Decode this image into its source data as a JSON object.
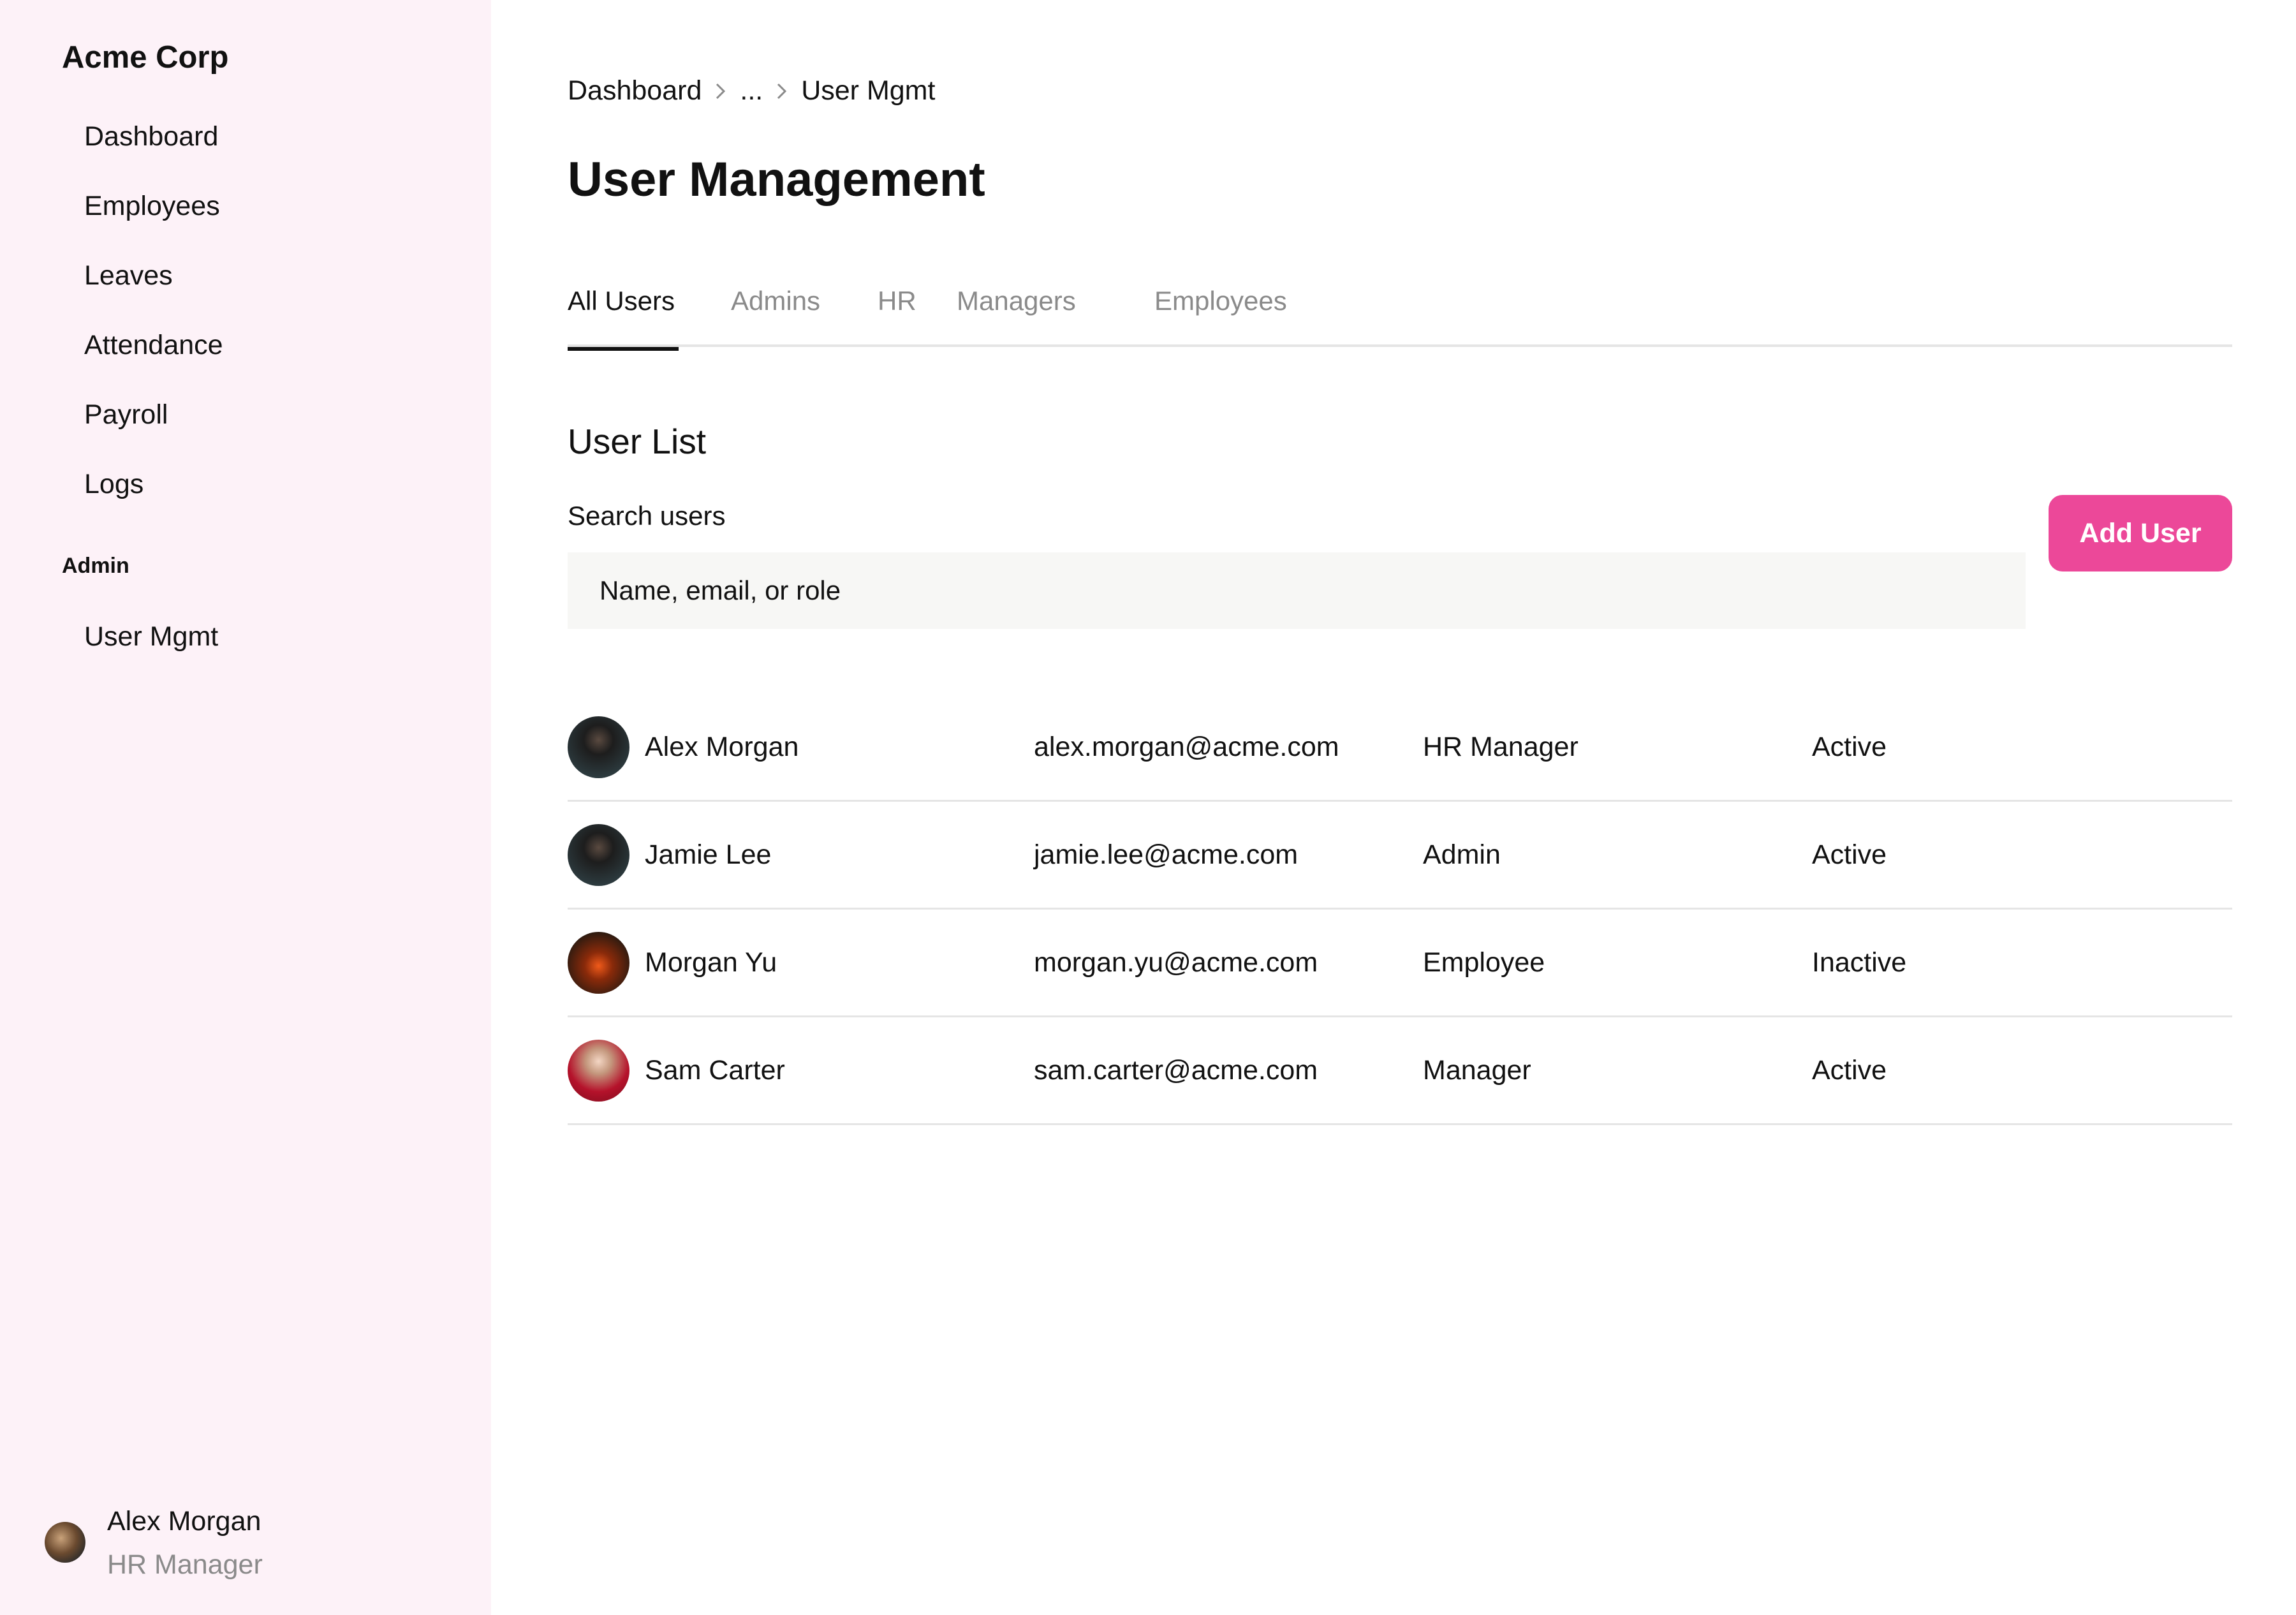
{
  "sidebar": {
    "brand": "Acme Corp",
    "items": [
      {
        "label": "Dashboard"
      },
      {
        "label": "Employees"
      },
      {
        "label": "Leaves"
      },
      {
        "label": "Attendance"
      },
      {
        "label": "Payroll"
      },
      {
        "label": "Logs"
      }
    ],
    "section_label": "Admin",
    "admin_items": [
      {
        "label": "User Mgmt"
      }
    ],
    "profile": {
      "name": "Alex Morgan",
      "role": "HR Manager"
    }
  },
  "breadcrumb": {
    "items": [
      "Dashboard",
      "...",
      "User Mgmt"
    ]
  },
  "page_title": "User Management",
  "tabs": [
    {
      "label": "All Users",
      "active": true
    },
    {
      "label": "Admins",
      "active": false
    },
    {
      "label": "HR",
      "active": false
    },
    {
      "label": "Managers",
      "active": false
    },
    {
      "label": "Employees",
      "active": false
    }
  ],
  "user_list": {
    "title": "User List",
    "search_label": "Search users",
    "search_placeholder": "Name, email, or role",
    "add_button": "Add User",
    "accent_color": "#ec4899",
    "users": [
      {
        "name": "Alex Morgan",
        "email": "alex.morgan@acme.com",
        "role": "HR Manager",
        "status": "Active"
      },
      {
        "name": "Jamie Lee",
        "email": "jamie.lee@acme.com",
        "role": "Admin",
        "status": "Active"
      },
      {
        "name": "Morgan Yu",
        "email": "morgan.yu@acme.com",
        "role": "Employee",
        "status": "Inactive"
      },
      {
        "name": "Sam Carter",
        "email": "sam.carter@acme.com",
        "role": "Manager",
        "status": "Active"
      }
    ]
  }
}
